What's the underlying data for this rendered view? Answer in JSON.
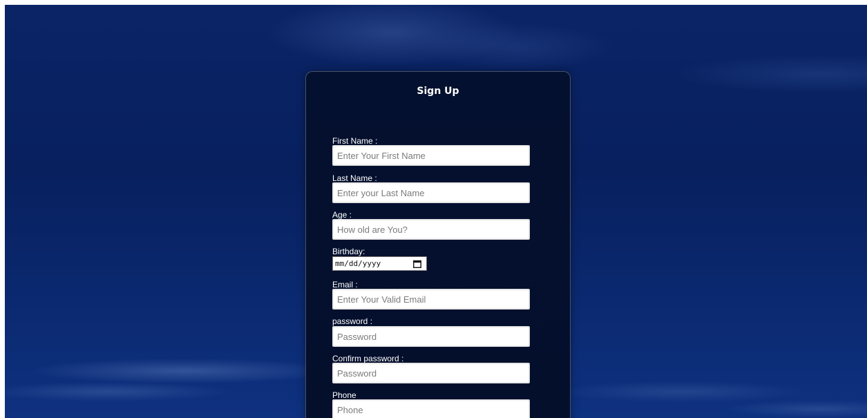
{
  "form": {
    "title": "Sign Up",
    "fields": {
      "first_name": {
        "label": "First Name :",
        "placeholder": "Enter Your First Name"
      },
      "last_name": {
        "label": "Last Name :",
        "placeholder": "Enter your Last Name"
      },
      "age": {
        "label": "Age :",
        "placeholder": "How old are You?"
      },
      "birthday": {
        "label": "Birthday:",
        "placeholder": "mm/dd/yyyy"
      },
      "email": {
        "label": "Email :",
        "placeholder": "Enter Your Valid Email"
      },
      "password": {
        "label": "password :",
        "placeholder": "Password"
      },
      "confirm_password": {
        "label": "Confirm password :",
        "placeholder": "Password"
      },
      "phone": {
        "label": "Phone",
        "placeholder": "Phone"
      }
    }
  },
  "icons": {
    "birthday_picker": "calendar-icon"
  },
  "colors": {
    "background": "#0a2466",
    "card": "#04102f",
    "label_text": "#ffffff",
    "placeholder_text": "#7b7b7b"
  }
}
